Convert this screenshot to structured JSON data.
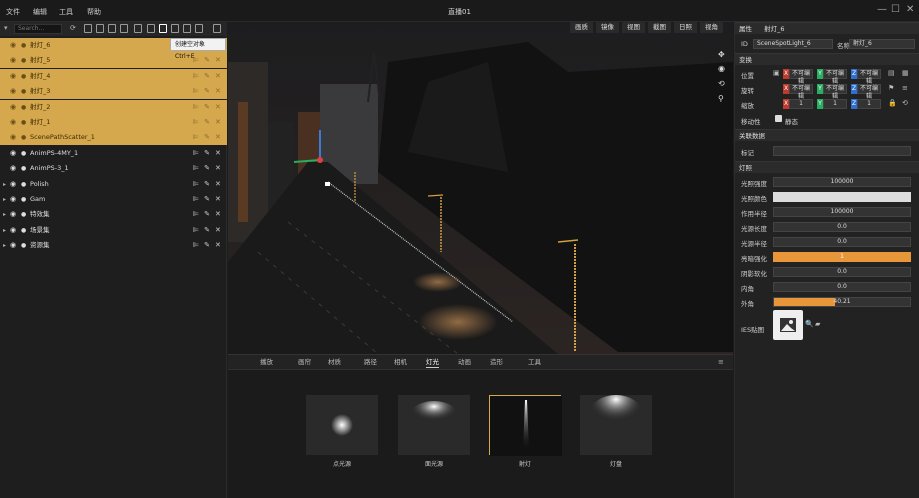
{
  "menubar": {
    "file": "文件",
    "edit": "编辑",
    "tools": "工具",
    "help": "帮助",
    "title": "直播01",
    "minimize": "—",
    "maximize": "☐",
    "close": "✕"
  },
  "outliner": {
    "search_placeholder": "Search...",
    "tooltip": "创建空对象 Ctrl+E",
    "rows": [
      {
        "label": "射灯_6"
      },
      {
        "label": "射灯_5"
      },
      {
        "label": "射灯_4"
      },
      {
        "label": "射灯_3"
      },
      {
        "label": "射灯_2"
      },
      {
        "label": "射灯_1"
      },
      {
        "label": "ScenePathScatter_1"
      },
      {
        "label": "AnimPS-4MY_1"
      },
      {
        "label": "AnimPS-3_1"
      },
      {
        "label": "Polish"
      },
      {
        "label": "Gam"
      },
      {
        "label": "特效集"
      },
      {
        "label": "场景集"
      },
      {
        "label": "资源集"
      }
    ]
  },
  "viewport": {
    "tabs": [
      "画质",
      "镜像",
      "视图",
      "截图",
      "日照",
      "视角"
    ]
  },
  "bottom": {
    "tabs": [
      "",
      "播放",
      "画帘",
      "材质",
      "路径",
      "相机",
      "灯光",
      "动画",
      "造形",
      "工具"
    ],
    "cards": [
      {
        "label": "点光源"
      },
      {
        "label": "面光源"
      },
      {
        "label": "射灯"
      },
      {
        "label": "灯盘"
      }
    ]
  },
  "properties": {
    "header_title": "属性",
    "object_name": "射灯_6",
    "id_label": "ID",
    "id_value": "SceneSpotLight_6",
    "name_label": "名称",
    "name_value": "射灯_6",
    "transform_title": "变换",
    "position_label": "位置",
    "rotation_label": "旋转",
    "scale_label": "缩放",
    "pos_x": "不可编辑",
    "pos_y": "不可编辑",
    "pos_z": "不可编辑",
    "rot_x": "不可编辑",
    "rot_y": "不可编辑",
    "rot_z": "不可编辑",
    "scale_x": "1",
    "scale_y": "1",
    "scale_z": "1",
    "movable_label": "移动性",
    "movable_value": "静态",
    "related_title": "关联数据",
    "tag_label": "标记",
    "lighting_title": "灯照",
    "intensity_label": "光照强度",
    "intensity_value": "100000",
    "color_label": "光照颜色",
    "range_label": "作用半径",
    "range_value": "100000",
    "source_len_label": "光源长度",
    "source_len_value": "0.0",
    "source_radius_label": "光源半径",
    "source_radius_value": "0.0",
    "ambient_label": "亮暗强化",
    "ambient_value": "1",
    "shadow_label": "阴影软化",
    "shadow_value": "0.0",
    "inner_label": "内角",
    "inner_value": "0.0",
    "outer_label": "外角",
    "outer_value": "40.21",
    "ies_label": "IES贴图"
  },
  "colors": {
    "selection": "#d6a84d",
    "accent": "#e8963a"
  }
}
